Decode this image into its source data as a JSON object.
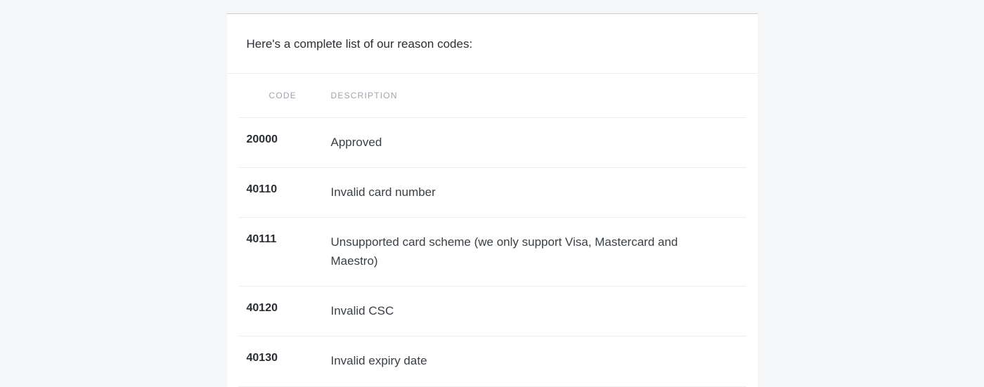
{
  "intro": "Here's a complete list of our reason codes:",
  "headers": {
    "code": "CODE",
    "description": "DESCRIPTION"
  },
  "rows": [
    {
      "code": "20000",
      "description": "Approved"
    },
    {
      "code": "40110",
      "description": "Invalid card number"
    },
    {
      "code": "40111",
      "description": "Unsupported card scheme (we only support Visa, Mastercard and Maestro)"
    },
    {
      "code": "40120",
      "description": "Invalid CSC"
    },
    {
      "code": "40130",
      "description": "Invalid expiry date"
    }
  ]
}
